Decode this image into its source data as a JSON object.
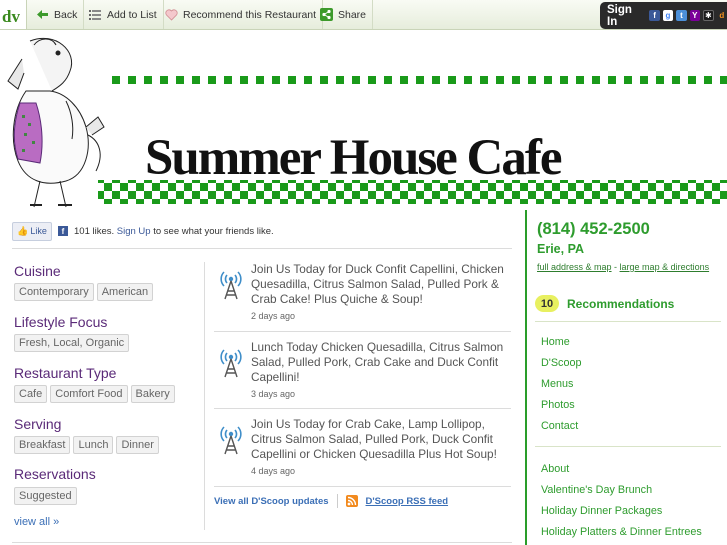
{
  "toolbar": {
    "logo_text": "dv",
    "back_label": "Back",
    "add_to_list_label": "Add to List",
    "recommend_label": "Recommend this Restaurant",
    "share_label": "Share",
    "signin_label": "Sign In"
  },
  "banner": {
    "title": "Summer House Cafe"
  },
  "facebook": {
    "like_label": "Like",
    "likes_count": "101 likes.",
    "signup_label": "Sign Up",
    "signup_suffix": "to see what your friends like."
  },
  "facets": [
    {
      "heading": "Cuisine",
      "tags": [
        "Contemporary",
        "American"
      ]
    },
    {
      "heading": "Lifestyle Focus",
      "tags": [
        "Fresh, Local, Organic"
      ]
    },
    {
      "heading": "Restaurant Type",
      "tags": [
        "Cafe",
        "Comfort Food",
        "Bakery"
      ]
    },
    {
      "heading": "Serving",
      "tags": [
        "Breakfast",
        "Lunch",
        "Dinner"
      ]
    },
    {
      "heading": "Reservations",
      "tags": [
        "Suggested"
      ]
    }
  ],
  "view_all_label": "view all »",
  "feed": {
    "posts": [
      {
        "text": "Join Us Today for Duck Confit Capellini, Chicken Quesadilla, Citrus Salmon Salad, Pulled Pork & Crab Cake! Plus Quiche & Soup!",
        "time": "2 days ago"
      },
      {
        "text": "Lunch Today Chicken Quesadilla, Citrus Salmon Salad, Pulled Pork, Crab Cake and Duck Confit Capellini!",
        "time": "3 days ago"
      },
      {
        "text": "Join Us Today for Crab Cake, Lamp Lollipop, Citrus Salmon Salad, Pulled Pork, Duck Confit Capellini or Chicken Quesadilla Plus Hot Soup!",
        "time": "4 days ago"
      }
    ],
    "view_all_label": "View all D'Scoop updates",
    "rss_label": "D'Scoop RSS feed"
  },
  "sidebar": {
    "phone": "(814) 452-2500",
    "city": "Erie, PA",
    "address_link": "full address & map",
    "separator": " - ",
    "map_link": "large map & directions",
    "rec_count": "10",
    "rec_label": "Recommendations",
    "nav_main": [
      "Home",
      "D'Scoop",
      "Menus",
      "Photos",
      "Contact"
    ],
    "nav_extra": [
      "About",
      "Valentine's Day Brunch",
      "Holiday Dinner Packages",
      "Holiday Platters & Dinner Entrees"
    ]
  },
  "colors": {
    "brand_green": "#2e9c2e",
    "facet_purple": "#5a2a78",
    "link_blue": "#3b6fb6",
    "checker_green": "#1a9a1a"
  }
}
